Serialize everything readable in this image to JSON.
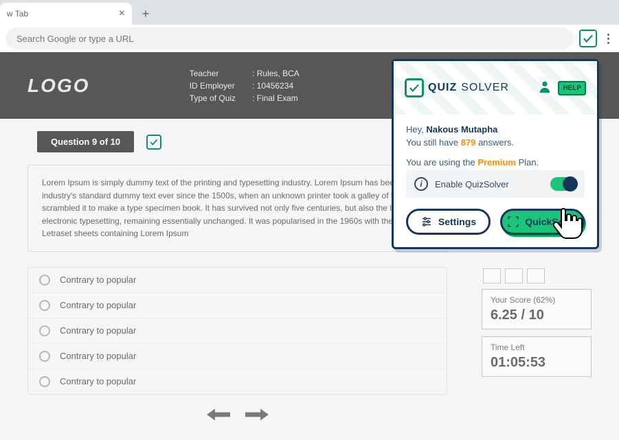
{
  "browser": {
    "tab_title": "w Tab",
    "addr_placeholder": "Search Google or type a URL"
  },
  "header": {
    "logo": "Logo",
    "meta_labels": {
      "teacher": "Teacher",
      "id_employer": "ID Employer",
      "type_of_quiz": "Type of Quiz"
    },
    "meta_values": {
      "teacher": "Rules, BCA",
      "id_employer": "10456234",
      "type_of_quiz": "Final Exam"
    }
  },
  "quiz": {
    "question_badge": "Question 9 of 10",
    "question_text": "Lorem Ipsum is simply dummy text of the printing and typesetting industry. Lorem Ipsum has been the industry's standard dummy text ever since the 1500s, when an unknown printer took a galley of type and scrambled it to make a type specimen book. It has survived not only five centuries, but also the leap into electronic typesetting, remaining essentially unchanged. It was popularised in the 1960s with the release of Letraset sheets containing Lorem Ipsum",
    "options": [
      "Contrary to popular",
      "Contrary to popular",
      "Contrary to popular",
      "Contrary to popular",
      "Contrary to popular"
    ],
    "score_label": "Your Score (62%)",
    "score_value": "6.25 / 10",
    "time_label": "Time Left",
    "time_value": "01:05:53"
  },
  "popup": {
    "brand1": "QUIZ",
    "brand2": "SOLVER",
    "help": "HELP",
    "greeting_prefix": "Hey, ",
    "user_name": "Nakous Mutapha",
    "answers_prefix": "You still have ",
    "answers_count": "879",
    "answers_suffix": " answers.",
    "plan_prefix": "You are using the ",
    "plan_name": "Premium",
    "plan_suffix": " Plan.",
    "enable_label": "Enable QuizSolver",
    "settings_label": "Settings",
    "quick_label": "QuickSolve"
  }
}
